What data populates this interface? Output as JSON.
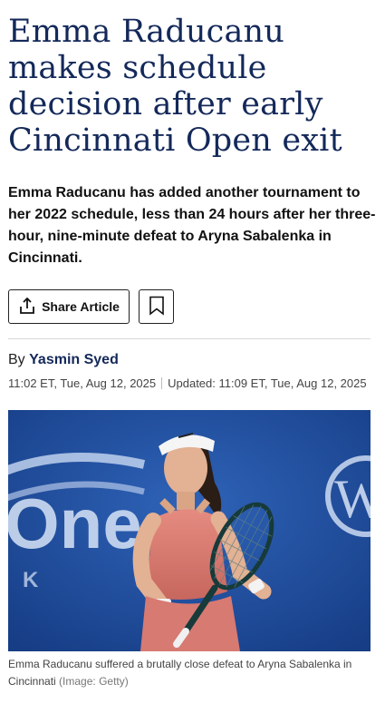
{
  "article": {
    "headline": "Emma Raducanu makes schedule decision after early Cincinnati Open exit",
    "standfirst": "Emma Raducanu has added another tournament to her 2022 schedule, less than 24 hours after her three-hour, nine-minute defeat to Aryna Sabalenka in Cincinnati.",
    "share_label": "Share Article",
    "byline_prefix": "By",
    "author": "Yasmin Syed",
    "published": "11:02 ET, Tue, Aug 12, 2025",
    "updated": "Updated: 11:09 ET, Tue, Aug 12, 2025",
    "image": {
      "caption": "Emma Raducanu suffered a brutally close defeat to Aryna Sabalenka in Cincinnati",
      "credit": "(Image: Getty)",
      "background_text_left": "One",
      "background_text_left_small": "K",
      "background_text_right": "W"
    }
  },
  "colors": {
    "headline": "#14295a",
    "author": "#14295a",
    "photo_background": "#1f4b9a"
  },
  "icons": {
    "share": "share-icon",
    "bookmark": "bookmark-icon"
  }
}
